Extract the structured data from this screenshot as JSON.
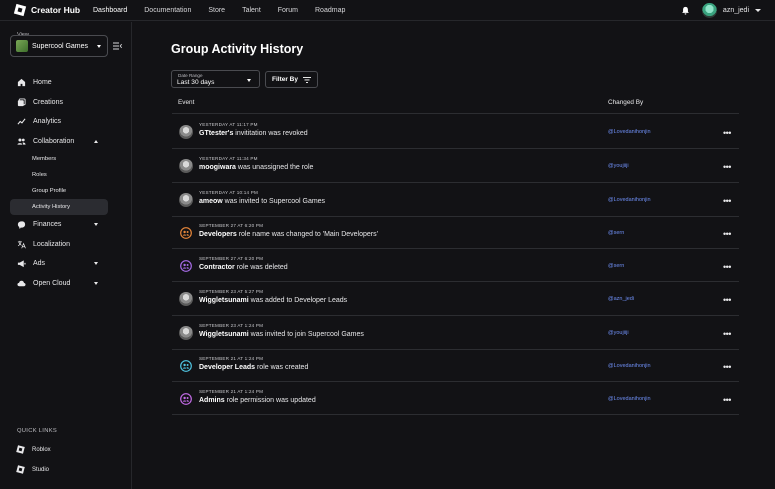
{
  "topbar": {
    "logo": "Creator Hub",
    "nav": [
      "Dashboard",
      "Documentation",
      "Store",
      "Talent",
      "Forum",
      "Roadmap"
    ],
    "user": "azn_jedi"
  },
  "sidebar": {
    "view_label": "View",
    "view_value": "Supercool Games",
    "items": [
      {
        "label": "Home",
        "icon": "home-icon"
      },
      {
        "label": "Creations",
        "icon": "creations-icon"
      },
      {
        "label": "Analytics",
        "icon": "analytics-icon"
      },
      {
        "label": "Collaboration",
        "icon": "collaboration-icon"
      },
      {
        "label": "Finances",
        "icon": "finances-icon"
      },
      {
        "label": "Localization",
        "icon": "localization-icon"
      },
      {
        "label": "Ads",
        "icon": "ads-icon"
      },
      {
        "label": "Open Cloud",
        "icon": "open-cloud-icon"
      }
    ],
    "collaboration_sub": [
      "Members",
      "Roles",
      "Group Profile",
      "Activity History"
    ],
    "quick_links_title": "QUICK LINKS",
    "quick_links": [
      "Roblox",
      "Studio"
    ]
  },
  "main": {
    "title": "Group Activity History",
    "date_range_label": "Date Range",
    "date_range_value": "Last 30 days",
    "filter_label": "Filter By",
    "col_event": "Event",
    "col_changed_by": "Changed By",
    "rows": [
      {
        "ts": "YESTERDAY AT 11:17 PM",
        "subject": "GTtester's",
        "rest": " invititation was revoked",
        "by": "@Lovedanihonjin",
        "avatar": "user"
      },
      {
        "ts": "YESTERDAY AT 11:34 PM",
        "subject": "moogiwara",
        "rest": " was unassigned the role",
        "by": "@youjiiji",
        "avatar": "user"
      },
      {
        "ts": "YESTERDAY AT 10:14 PM",
        "subject": "ameow",
        "rest": " was invited to Supercool Games",
        "by": "@Lovedanihonjin",
        "avatar": "user"
      },
      {
        "ts": "SEPTEMBER 27 AT 6:20 PM",
        "subject": "Developers",
        "rest": " role name was changed to 'Main Developers'",
        "by": "@sern",
        "avatar": "role",
        "color": "#e8873a"
      },
      {
        "ts": "SEPTEMBER 27 AT 6:20 PM",
        "subject": "Contractor",
        "rest": " role was deleted",
        "by": "@sern",
        "avatar": "role",
        "color": "#a66be6"
      },
      {
        "ts": "SEPTEMBER 23 AT 5:27 PM",
        "subject": "Wiggletsunami",
        "rest": " was added to Developer Leads",
        "by": "@azn_jedi",
        "avatar": "user"
      },
      {
        "ts": "SEPTEMBER 23 AT 1:24 PM",
        "subject": "Wiggletsunami",
        "rest": " was invited to join Supercool Games",
        "by": "@youjiiji",
        "avatar": "user"
      },
      {
        "ts": "SEPTEMBER 21 AT 1:24 PM",
        "subject": "Developer Leads",
        "rest": " role was created",
        "by": "@Lovedanihonjin",
        "avatar": "role",
        "color": "#4fc3e0"
      },
      {
        "ts": "SEPTEMBER 21 AT 1:24 PM",
        "subject": "Admins",
        "rest": " role permission was updated",
        "by": "@Lovedanihonjin",
        "avatar": "role",
        "color": "#c36be6"
      }
    ]
  }
}
